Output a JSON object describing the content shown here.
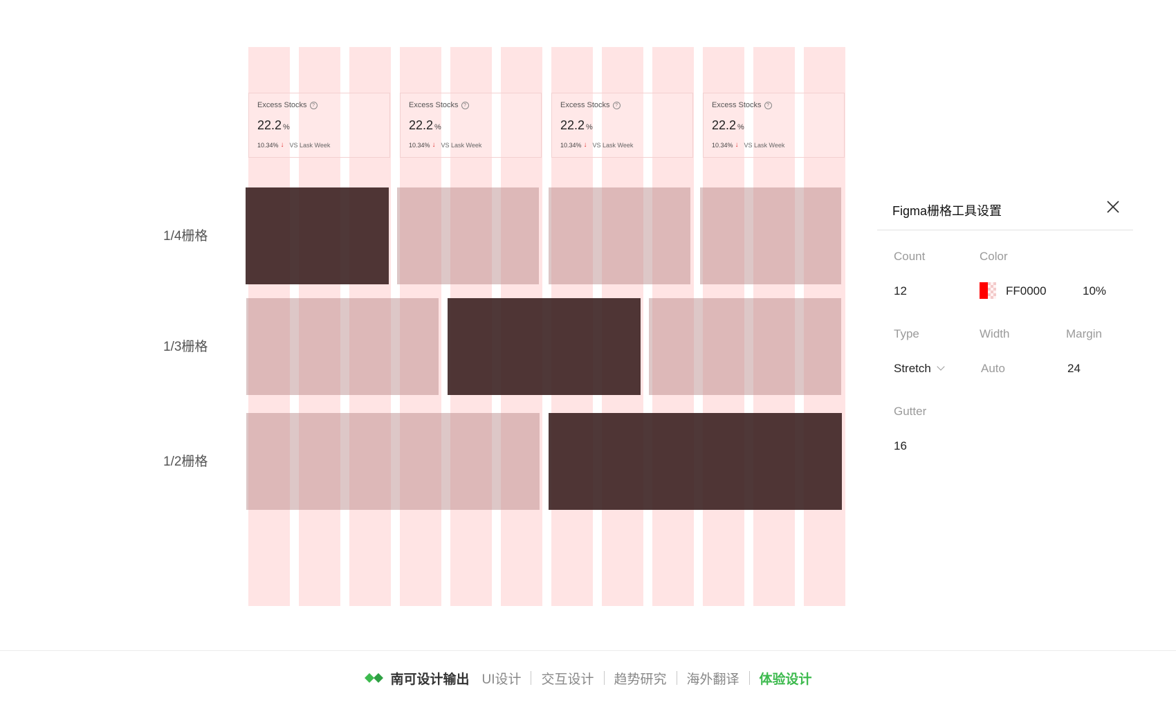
{
  "cards": [
    {
      "title": "Excess Stocks",
      "value": "22.2",
      "unit": "%",
      "change": "10.34%",
      "compare": "VS Lask Week"
    },
    {
      "title": "Excess Stocks",
      "value": "22.2",
      "unit": "%",
      "change": "10.34%",
      "compare": "VS Lask Week"
    },
    {
      "title": "Excess Stocks",
      "value": "22.2",
      "unit": "%",
      "change": "10.34%",
      "compare": "VS Lask Week"
    },
    {
      "title": "Excess Stocks",
      "value": "22.2",
      "unit": "%",
      "change": "10.34%",
      "compare": "VS Lask Week"
    }
  ],
  "rows": {
    "quarter": "1/4栅格",
    "third": "1/3栅格",
    "half": "1/2栅格"
  },
  "panel": {
    "title": "Figma栅格工具设置",
    "count_label": "Count",
    "count_value": "12",
    "color_label": "Color",
    "color_value": "FF0000",
    "opacity_value": "10%",
    "type_label": "Type",
    "type_value": "Stretch",
    "width_label": "Width",
    "width_value": "Auto",
    "margin_label": "Margin",
    "margin_value": "24",
    "gutter_label": "Gutter",
    "gutter_value": "16",
    "swatch_color": "#FF0000"
  },
  "footer": {
    "brand": "南可设计输出",
    "links": [
      "UI设计",
      "交互设计",
      "趋势研究",
      "海外翻译",
      "体验设计"
    ],
    "active_color": "#3DBA4E"
  }
}
